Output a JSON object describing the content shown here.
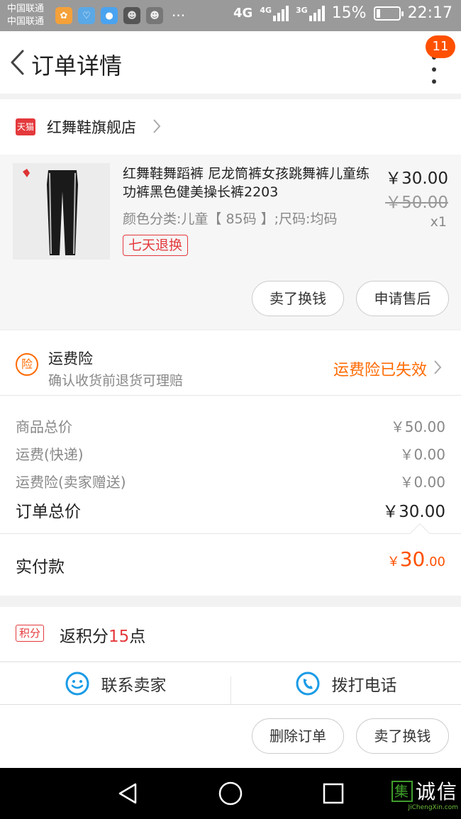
{
  "status_bar": {
    "carrier_1": "中国联通",
    "carrier_2": "中国联通",
    "more": "···",
    "network_1": "4G",
    "network_2": "4G",
    "network_3": "3G",
    "battery": "15%",
    "time": "22:17"
  },
  "header": {
    "title": "订单详情",
    "badge_count": "11"
  },
  "store": {
    "platform_badge": "天猫",
    "name": "红舞鞋旗舰店"
  },
  "product": {
    "title": "红舞鞋舞蹈裤 尼龙筒裤女孩跳舞裤儿童练功裤黑色健美操长裤2203",
    "sku": "颜色分类:儿童【 85码 】;尺码:均码",
    "tag": "七天退换",
    "price": "￥30.00",
    "original_price": "￥50.00",
    "quantity": "x1",
    "actions": {
      "sell": "卖了换钱",
      "after_sale": "申请售后"
    }
  },
  "insurance": {
    "icon_label": "险",
    "title": "运费险",
    "subtitle": "确认收货前退货可理赔",
    "status": "运费险已失效"
  },
  "costs": {
    "items": [
      {
        "label": "商品总价",
        "value": "￥50.00"
      },
      {
        "label": "运费(快递)",
        "value": "￥0.00"
      },
      {
        "label": "运费险(卖家赠送)",
        "value": "￥0.00"
      }
    ],
    "total_label": "订单总价",
    "total_value": "￥30.00",
    "paid_label": "实付款",
    "paid_currency": "￥",
    "paid_integer": "30",
    "paid_decimal": ".00"
  },
  "points": {
    "tag": "积分",
    "prefix": "返积分",
    "number": "15",
    "suffix": "点"
  },
  "contact": {
    "seller": "联系卖家",
    "phone": "拨打电话"
  },
  "footer": {
    "delete": "删除订单",
    "sell": "卖了换钱"
  },
  "watermark": {
    "box_char": "集",
    "main": "诚信",
    "sub": "JiChengXin.com"
  },
  "colors": {
    "accent_orange": "#ff5000",
    "tmall_red": "#e4393c",
    "insurance_orange": "#ff6a00"
  }
}
